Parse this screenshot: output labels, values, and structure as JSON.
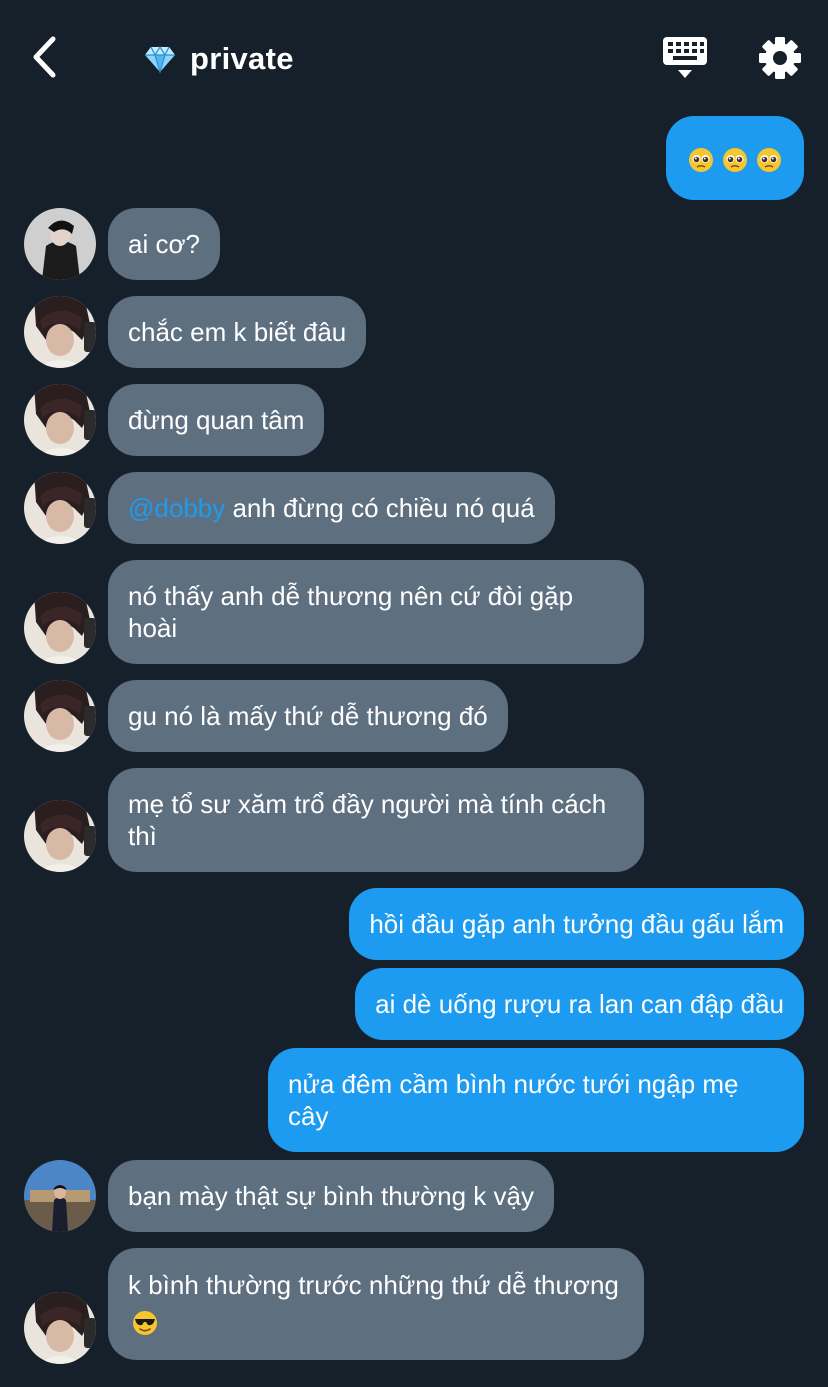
{
  "header": {
    "back_icon": "chevron-left-icon",
    "title_icon": "diamond-icon",
    "title": "private",
    "keyboard_icon": "keyboard-icon",
    "settings_icon": "gear-icon"
  },
  "colors": {
    "background": "#15202b",
    "incoming_bubble": "#5e6f80",
    "outgoing_bubble": "#1d9bf0",
    "mention": "#1d9bf0"
  },
  "messages": [
    {
      "direction": "out",
      "emoji": [
        "pleading-face",
        "pleading-face",
        "pleading-face"
      ]
    },
    {
      "direction": "in",
      "avatar": "dark-avatar",
      "text": "ai cơ?"
    },
    {
      "direction": "in",
      "avatar": "user-avatar",
      "text": "chắc em k biết đâu"
    },
    {
      "direction": "in",
      "avatar": "user-avatar",
      "text": "đừng quan tâm"
    },
    {
      "direction": "in",
      "avatar": "user-avatar",
      "mention": "@dobby",
      "text": " anh đừng có chiều nó quá"
    },
    {
      "direction": "in",
      "avatar": "user-avatar",
      "text": "nó thấy anh dễ thương nên cứ đòi gặp hoài"
    },
    {
      "direction": "in",
      "avatar": "user-avatar",
      "text": "gu nó là mấy thứ dễ thương đó"
    },
    {
      "direction": "in",
      "avatar": "user-avatar",
      "text": "mẹ tổ sư xăm trổ đầy người mà tính cách thì"
    },
    {
      "direction": "out",
      "text": "hồi đầu gặp anh tưởng đầu gấu lắm"
    },
    {
      "direction": "out",
      "text": "ai dè uống rượu ra lan can đập đầu"
    },
    {
      "direction": "out",
      "text": "nửa đêm cầm bình nước tưới ngập mẹ cây"
    },
    {
      "direction": "in",
      "avatar": "outdoor-avatar",
      "text": "bạn mày thật sự bình thường k vậy"
    },
    {
      "direction": "in",
      "avatar": "user-avatar",
      "text": "k bình thường trước những thứ dễ thương",
      "emoji": "smiling-face-with-sunglasses"
    }
  ]
}
